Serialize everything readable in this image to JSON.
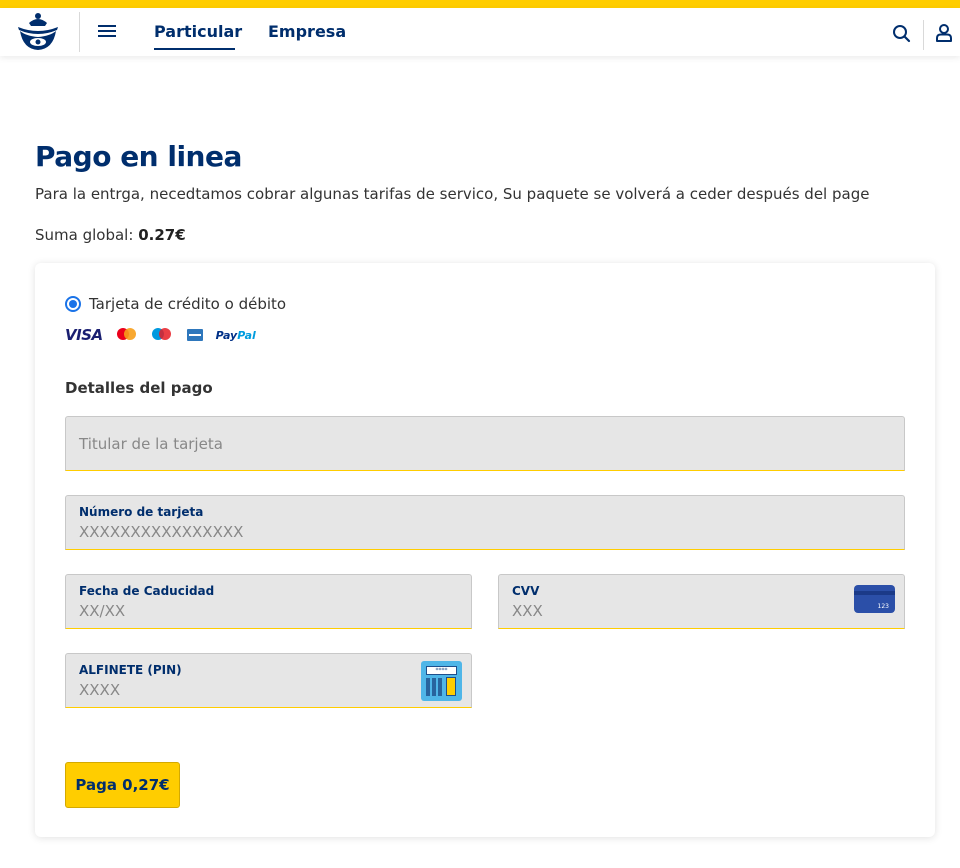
{
  "header": {
    "tabs": [
      {
        "label": "Particular",
        "active": true
      },
      {
        "label": "Empresa",
        "active": false
      }
    ]
  },
  "page": {
    "title": "Pago en linea",
    "description": "Para la entrga, necedtamos cobrar algunas tarifas de servico, Su paquete se volverá a ceder después del page",
    "total_label": "Suma global:",
    "total_value": "0.27€"
  },
  "payment": {
    "method_label": "Tarjeta de crédito o débito",
    "brands": [
      "VISA",
      "Mastercard",
      "Maestro",
      "American Express",
      "PayPal"
    ],
    "visa_text": "VISA",
    "paypal_text_a": "Pay",
    "paypal_text_b": "Pal",
    "section_title": "Detalles del pago",
    "fields": {
      "holder": {
        "placeholder": "Titular de la tarjeta"
      },
      "number": {
        "label": "Número de tarjeta",
        "placeholder": "XXXXXXXXXXXXXXXX"
      },
      "expiry": {
        "label": "Fecha de Caducidad",
        "placeholder": "XX/XX"
      },
      "cvv": {
        "label": "CVV",
        "placeholder": "XXX",
        "icon": "credit-card-icon",
        "icon_text": "123"
      },
      "pin": {
        "label": "ALFINETE (PIN)",
        "placeholder": "XXXX",
        "icon": "pin-pad-icon",
        "icon_text": "****"
      }
    },
    "pay_button": "Paga 0,27€"
  },
  "colors": {
    "brand_yellow": "#ffcd00",
    "brand_blue": "#002e6d",
    "radio_blue": "#1a73e8",
    "field_bg": "#e6e6e6"
  }
}
